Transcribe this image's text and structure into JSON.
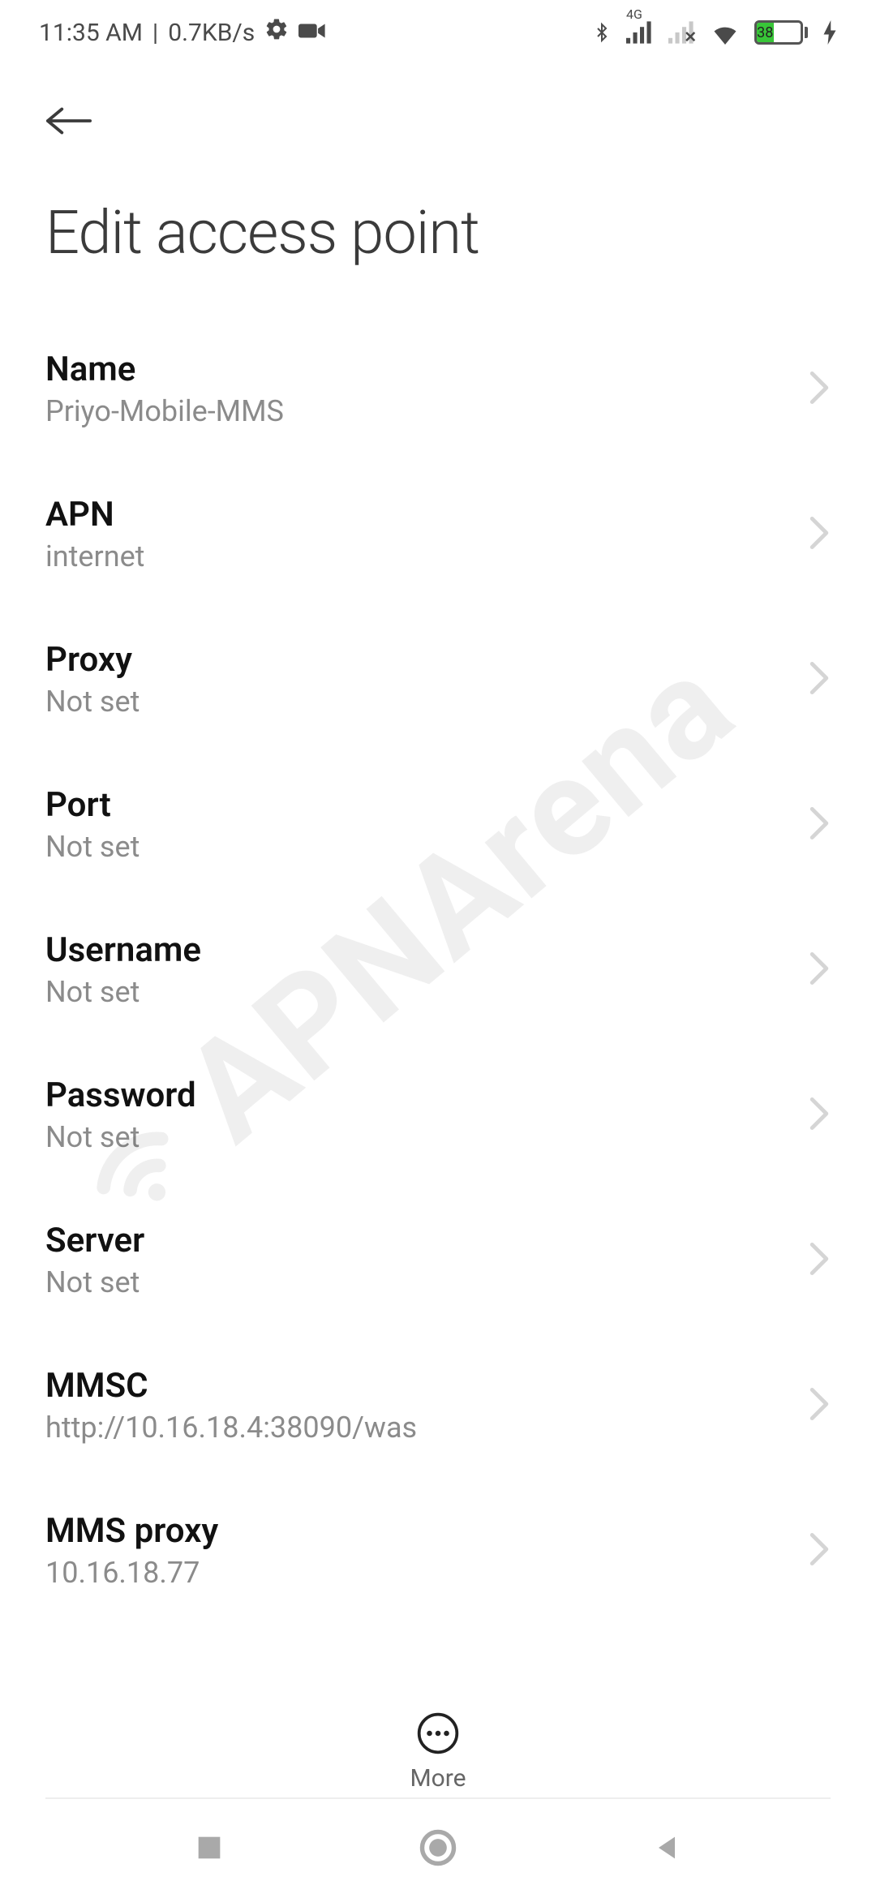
{
  "status": {
    "time": "11:35 AM",
    "sep": "|",
    "net_speed": "0.7KB/s",
    "battery_percent": "38",
    "network_label": "4G"
  },
  "header": {
    "title": "Edit access point"
  },
  "rows": [
    {
      "label": "Name",
      "value": "Priyo-Mobile-MMS"
    },
    {
      "label": "APN",
      "value": "internet"
    },
    {
      "label": "Proxy",
      "value": "Not set"
    },
    {
      "label": "Port",
      "value": "Not set"
    },
    {
      "label": "Username",
      "value": "Not set"
    },
    {
      "label": "Password",
      "value": "Not set"
    },
    {
      "label": "Server",
      "value": "Not set"
    },
    {
      "label": "MMSC",
      "value": "http://10.16.18.4:38090/was"
    },
    {
      "label": "MMS proxy",
      "value": "10.16.18.77"
    }
  ],
  "more": {
    "label": "More"
  },
  "watermark": {
    "text": "APNArena"
  }
}
